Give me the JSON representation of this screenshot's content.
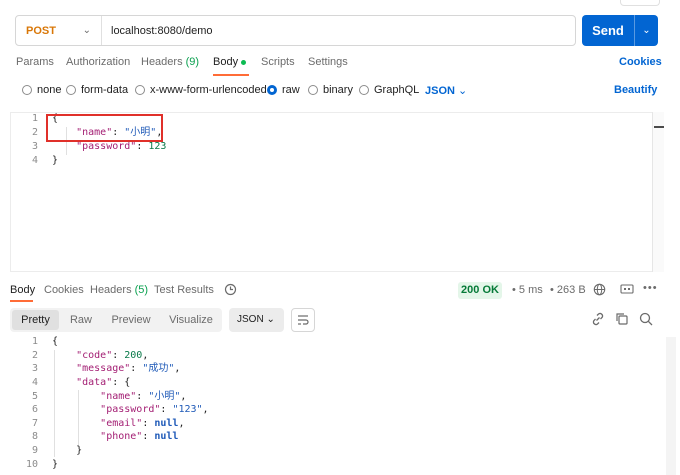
{
  "request": {
    "method": "POST",
    "url": "localhost:8080/demo",
    "send_label": "Send",
    "tabs": [
      "Params",
      "Authorization",
      "Headers",
      "Body",
      "Scripts",
      "Settings"
    ],
    "headers_count": "(9)",
    "cookies_link": "Cookies",
    "beautify_link": "Beautify",
    "body_types": [
      "none",
      "form-data",
      "x-www-form-urlencoded",
      "raw",
      "binary",
      "GraphQL"
    ],
    "selected_body_type": "raw",
    "format": "JSON",
    "lines": {
      "l1": "{",
      "l2_key": "\"name\"",
      "l2_val": "\"小明\"",
      "l3_key": "\"password\"",
      "l3_val": "123",
      "l4": "}"
    }
  },
  "response": {
    "tabs": [
      "Body",
      "Cookies",
      "Headers",
      "Test Results"
    ],
    "headers_count": "(5)",
    "status": "200 OK",
    "time": "5 ms",
    "size": "263 B",
    "view_modes": [
      "Pretty",
      "Raw",
      "Preview",
      "Visualize"
    ],
    "active_view": "Pretty",
    "format": "JSON",
    "lines": {
      "code_key": "\"code\"",
      "code_val": "200",
      "message_key": "\"message\"",
      "message_val": "\"成功\"",
      "data_key": "\"data\"",
      "name_key": "\"name\"",
      "name_val": "\"小明\"",
      "password_key": "\"password\"",
      "password_val": "\"123\"",
      "email_key": "\"email\"",
      "email_val": "null",
      "phone_key": "\"phone\"",
      "phone_val": "null"
    }
  },
  "colors": {
    "accent_send": "#0265d2",
    "method_post": "#d97708",
    "status_ok": "#067a38",
    "tab_active_underline": "#ff6c37",
    "highlight_box": "#e0302a"
  }
}
